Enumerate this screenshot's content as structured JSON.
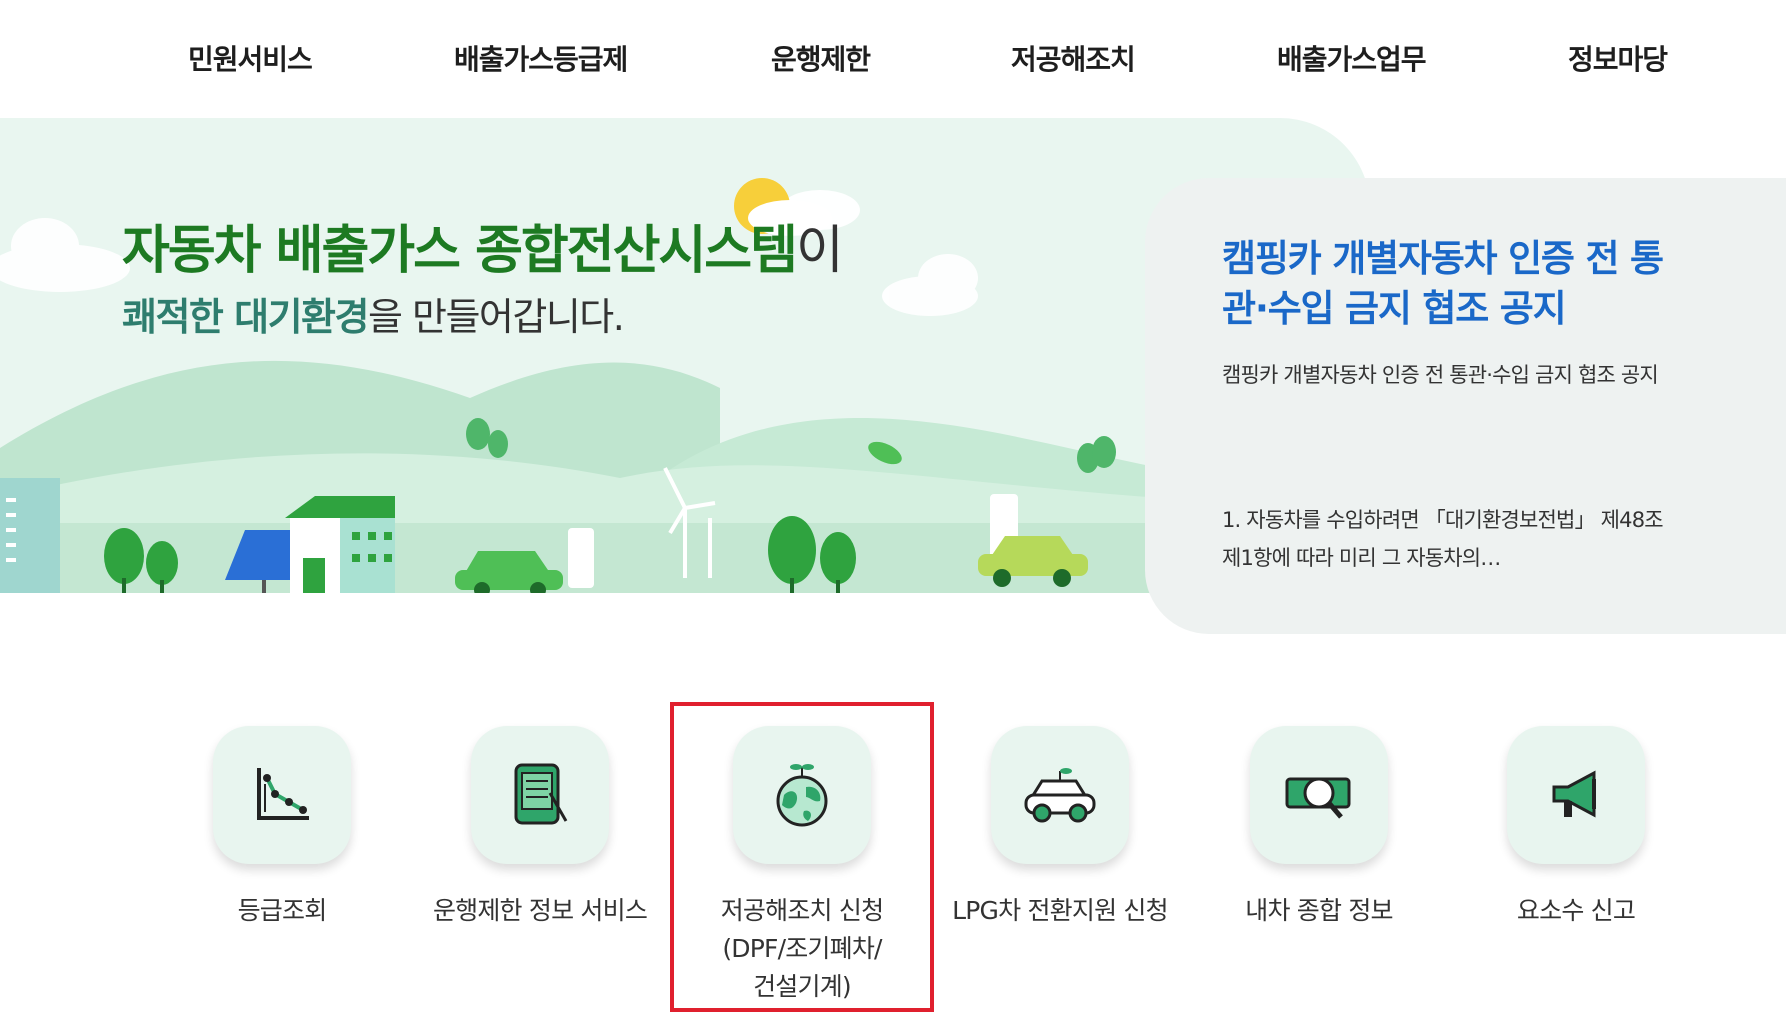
{
  "nav": {
    "items": [
      "민원서비스",
      "배출가스등급제",
      "운행제한",
      "저공해조치",
      "배출가스업무",
      "정보마당"
    ]
  },
  "hero": {
    "title_main": "자동차 배출가스 종합전산시스템",
    "title_suffix": "이",
    "sub_accent": "쾌적한 대기환경",
    "sub_rest": "을 만들어갑니다."
  },
  "notice": {
    "title": "캠핑카 개별자동차 인증 전 통관·수입 금지 협조 공지",
    "summary": "캠핑카 개별자동차 인증 전 통관·수입 금지 협조 공지",
    "body": "1. 자동차를 수입하려면 「대기환경보전법」 제48조제1항에 따라 미리 그 자동차의…"
  },
  "quick_menu": [
    {
      "label": "등급조회",
      "icon": "chart-icon"
    },
    {
      "label": "운행제한 정보 서비스",
      "icon": "tablet-icon"
    },
    {
      "label": "저공해조치 신청\n(DPF/조기폐차/\n건설기계)",
      "icon": "earth-icon"
    },
    {
      "label": "LPG차 전환지원 신청",
      "icon": "eco-car-icon"
    },
    {
      "label": "내차 종합 정보",
      "icon": "search-money-icon"
    },
    {
      "label": "요소수 신고",
      "icon": "megaphone-icon"
    }
  ],
  "colors": {
    "brand_green": "#1d7a22",
    "notice_blue": "#1a68c8",
    "icon_green": "#2fa56a",
    "highlight_red": "#e0202e"
  }
}
